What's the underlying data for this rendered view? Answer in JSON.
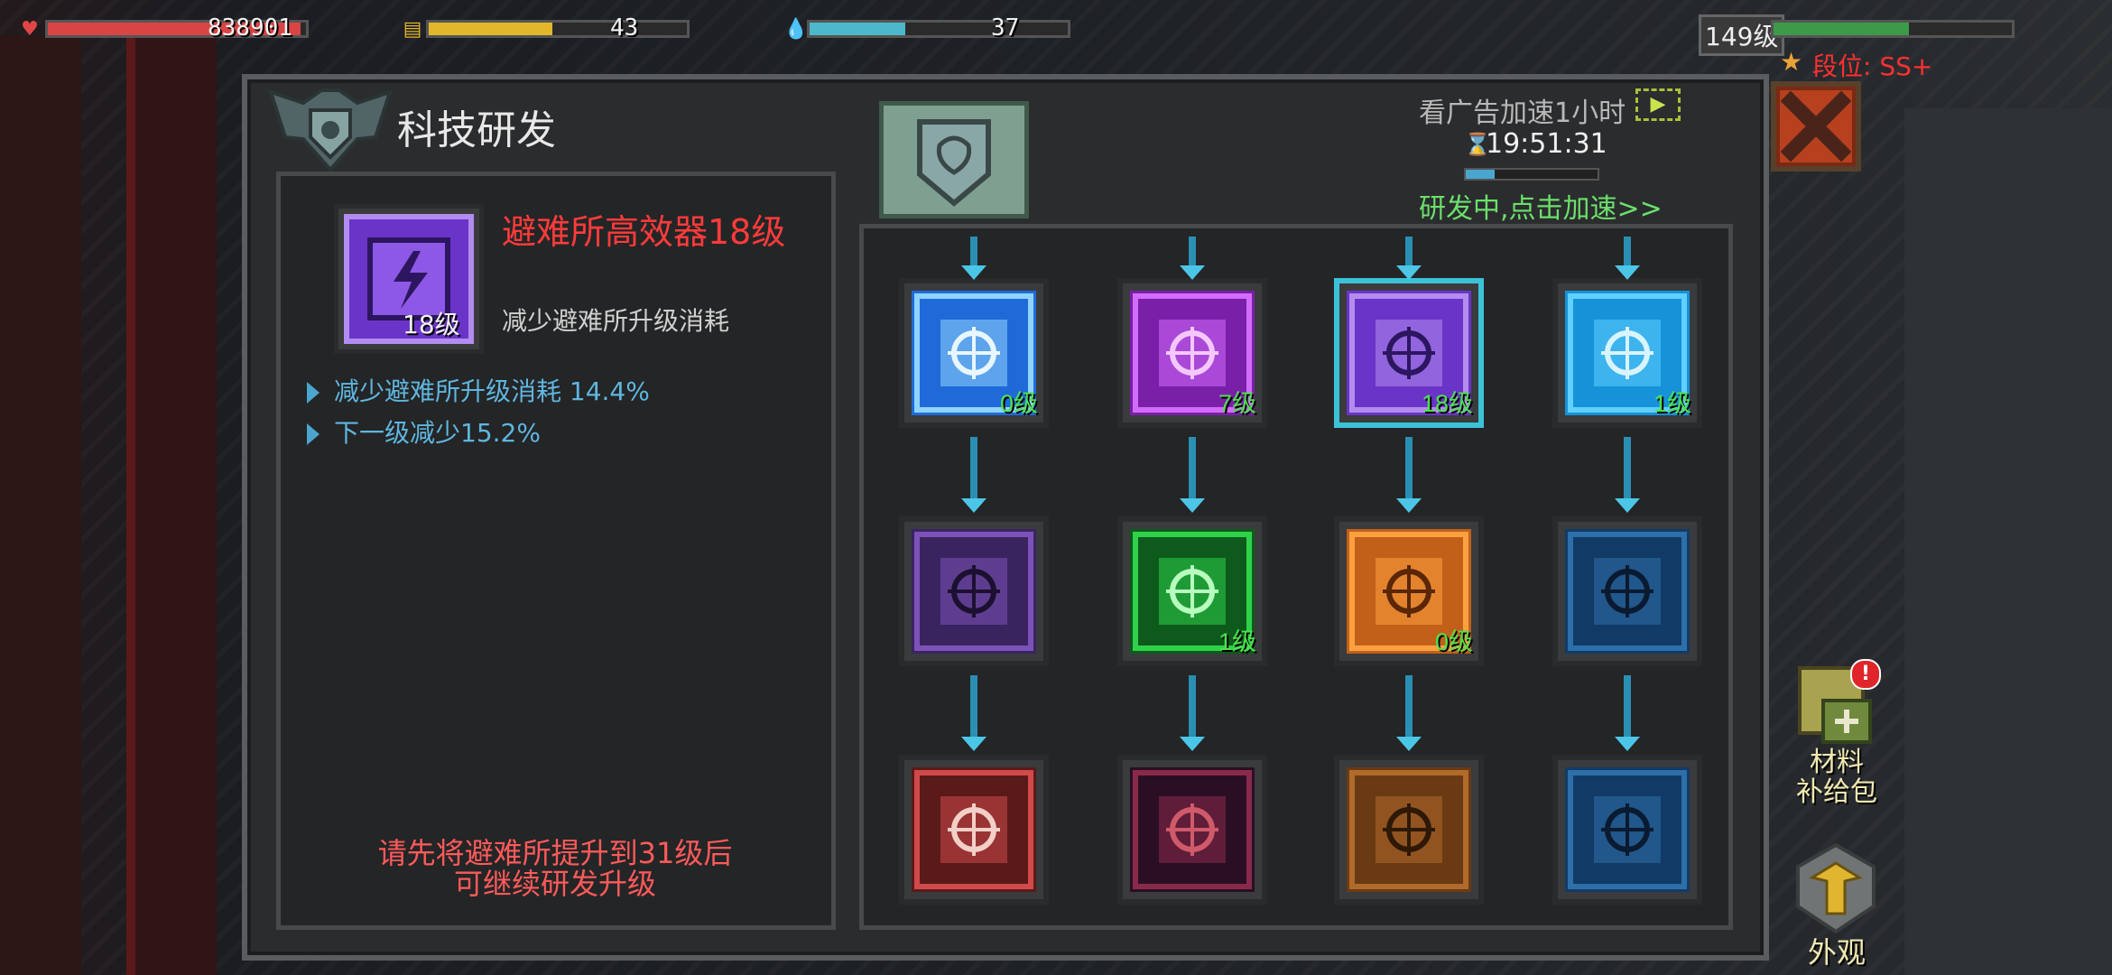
{
  "hud": {
    "hp": {
      "value": "838901",
      "fill": 0.98,
      "color": "#d94444"
    },
    "food": {
      "value": "43",
      "fill": 0.48,
      "color": "#e3b72a"
    },
    "water": {
      "value": "37",
      "fill": 0.37,
      "color": "#4cb8c9"
    },
    "player_level": "149级",
    "exp": {
      "fill": 0.57,
      "color": "#3d9a48"
    },
    "rank_label": "段位: SS+"
  },
  "panel": {
    "title": "科技研发",
    "ad_speedup": "看广告加速1小时",
    "ad_play_icon": "play-icon",
    "timer": "19:51:31",
    "research_progress": 0.22,
    "researching_text": "研发中,点击加速>>",
    "close_icon": "close-icon"
  },
  "selected": {
    "name": "避难所高效器18级",
    "level": "18级",
    "description": "减少避难所升级消耗",
    "effects": [
      "减少避难所升级消耗 14.4%",
      "下一级减少15.2%"
    ],
    "requirement_line1": "请先将避难所提升到31级后",
    "requirement_line2": "可继续研发升级"
  },
  "tree": {
    "rows": [
      [
        {
          "name": "blue-gun-icon",
          "level": "0级",
          "theme": "blue"
        },
        {
          "name": "purple-boot-icon",
          "level": "7级",
          "theme": "purple"
        },
        {
          "name": "shelter-efficiency-icon",
          "level": "18级",
          "theme": "violet",
          "selected": true
        },
        {
          "name": "blue-bag-icon",
          "level": "1级",
          "theme": "cyan"
        }
      ],
      [
        {
          "name": "purple-soldier-icon",
          "level": "",
          "theme": "dark-purple"
        },
        {
          "name": "crosshair-icon",
          "level": "1级",
          "theme": "green"
        },
        {
          "name": "orange-upgrade-icon",
          "level": "0级",
          "theme": "orange"
        },
        {
          "name": "dark-blue-case-icon",
          "level": "",
          "theme": "navy"
        }
      ],
      [
        {
          "name": "crossed-rifles-icon",
          "level": "",
          "theme": "red"
        },
        {
          "name": "dark-crosshair-icon",
          "level": "",
          "theme": "dark-red"
        },
        {
          "name": "bronze-efficiency-icon",
          "level": "",
          "theme": "bronze"
        },
        {
          "name": "medkit-case-icon",
          "level": "",
          "theme": "navy"
        }
      ]
    ]
  },
  "side": {
    "supply_label_1": "材料",
    "supply_label_2": "补给包",
    "supply_badge": "!",
    "skin_label": "外观"
  }
}
